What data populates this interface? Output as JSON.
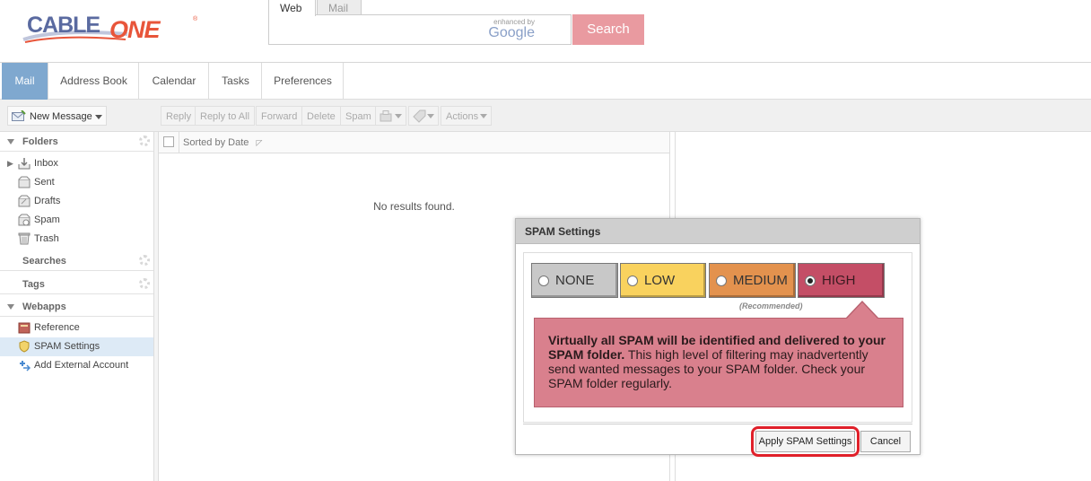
{
  "header": {
    "logo_cable": "CABLE",
    "logo_one": "ONE",
    "logo_tm": "®",
    "search_tabs": [
      "Web",
      "Mail"
    ],
    "google_enhanced": "enhanced by",
    "google_word": "Google",
    "search_button": "Search"
  },
  "app_tabs": [
    "Mail",
    "Address Book",
    "Calendar",
    "Tasks",
    "Preferences"
  ],
  "toolbar": {
    "new_message": "New Message",
    "reply": "Reply",
    "reply_all": "Reply to All",
    "forward": "Forward",
    "delete": "Delete",
    "spam": "Spam",
    "actions": "Actions"
  },
  "sidebar": {
    "folders_header": "Folders",
    "folders": [
      "Inbox",
      "Sent",
      "Drafts",
      "Spam",
      "Trash"
    ],
    "searches_header": "Searches",
    "tags_header": "Tags",
    "webapps_header": "Webapps",
    "webapps": [
      "Reference",
      "SPAM Settings",
      "Add External Account"
    ],
    "selected_item": "SPAM Settings"
  },
  "list": {
    "sort_label": "Sorted by Date",
    "empty_text": "No results found."
  },
  "dialog": {
    "title": "SPAM Settings",
    "levels": [
      {
        "label": "NONE",
        "color": "#c8c8c8",
        "selected": false
      },
      {
        "label": "LOW",
        "color": "#f9d25e",
        "selected": false
      },
      {
        "label": "MEDIUM",
        "color": "#e3924e",
        "selected": false
      },
      {
        "label": "HIGH",
        "color": "#c44e66",
        "selected": true
      }
    ],
    "recommended": "(Recommended)",
    "description_bold": "Virtually all SPAM will be identified and delivered to your SPAM folder.",
    "description_rest": " This high level of filtering may inadvertently send wanted messages to your SPAM folder. Check your SPAM folder regularly.",
    "apply_button": "Apply SPAM Settings",
    "cancel_button": "Cancel"
  },
  "colors": {
    "active_tab": "#7fa8cf",
    "search_button": "#e99aa0",
    "description_bg": "#d9808d",
    "highlight": "#e0202a"
  }
}
